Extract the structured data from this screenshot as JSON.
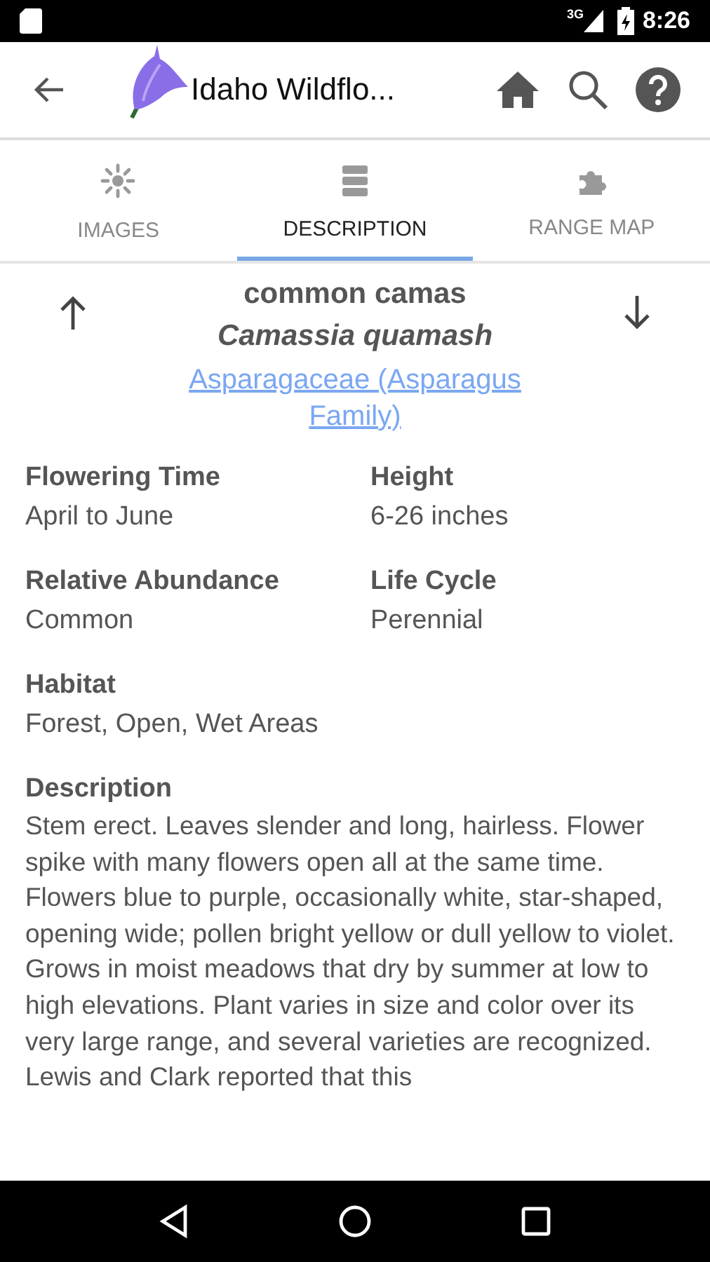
{
  "status_bar": {
    "network": "3G",
    "time": "8:26"
  },
  "app_bar": {
    "title": "Idaho Wildflo..."
  },
  "tabs": [
    {
      "label": "IMAGES",
      "selected": false
    },
    {
      "label": "DESCRIPTION",
      "selected": true
    },
    {
      "label": "RANGE MAP",
      "selected": false
    }
  ],
  "plant": {
    "common_name": "common camas",
    "scientific_name": "Camassia quamash",
    "family": "Asparagaceae (Asparagus Family)"
  },
  "facts": [
    {
      "label": "Flowering Time",
      "value": "April to June"
    },
    {
      "label": "Height",
      "value": "6-26 inches"
    },
    {
      "label": "Relative Abundance",
      "value": "Common"
    },
    {
      "label": "Life Cycle",
      "value": "Perennial"
    }
  ],
  "sections": [
    {
      "label": "Habitat",
      "value": "Forest, Open, Wet Areas"
    },
    {
      "label": "Description",
      "value": "Stem erect. Leaves slender and long, hairless. Flower spike with many flowers open all at the same time. Flowers blue to purple, occasionally white, star-shaped, opening wide; pollen bright yellow or dull yellow to violet. Grows in moist meadows that dry by summer at low to high elevations. Plant varies in size and color over its very large range, and several varieties are recognized. Lewis and Clark reported that this"
    }
  ]
}
